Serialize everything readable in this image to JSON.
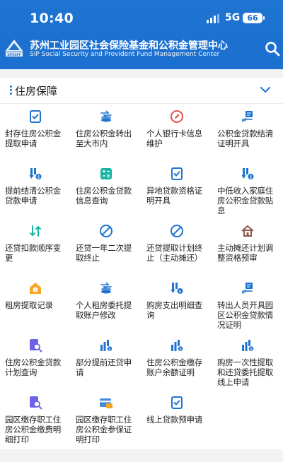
{
  "status_bar": {
    "time": "10:40",
    "network": "5G",
    "battery": "66"
  },
  "header": {
    "title_cn": "苏州工业园区社会保险基金和公积金管理中心",
    "title_en": "SIP Social Security and Provident Fund Management Center",
    "logo_text": "SIPSSPF",
    "search_icon": "search-icon"
  },
  "section": {
    "title": "住房保障",
    "toggle_icon": "chevron-down-icon"
  },
  "colors": {
    "primary": "#1f74d1",
    "red": "#e5534b",
    "orange": "#f5a623",
    "green": "#17b3a3",
    "purple": "#6d63e8",
    "brown": "#8c5a4e"
  },
  "items": [
    {
      "label": "封存住房公积金提取申请",
      "icon": "doc-check-icon"
    },
    {
      "label": "住房公积金转出至大市内",
      "icon": "coins-transfer-icon"
    },
    {
      "label": "个人银行卡信息维护",
      "icon": "edit-circle-icon"
    },
    {
      "label": "公积金贷款结清证明开具",
      "icon": "hand-card-icon"
    },
    {
      "label": "提前结清公积金贷款申请",
      "icon": "down-coin-icon"
    },
    {
      "label": "住房公积金贷款信息查询",
      "icon": "calculator-icon"
    },
    {
      "label": "异地贷款资格证明开具",
      "icon": "doc-check-icon"
    },
    {
      "label": "中低收入家庭住房公积金贷款贴息",
      "icon": "down-coin-icon"
    },
    {
      "label": "还贷扣款顺序变更",
      "icon": "swap-arrows-icon"
    },
    {
      "label": "还贷一年二次提取终止",
      "icon": "stop-circle-icon"
    },
    {
      "label": "还贷提取计划终止（主动摊还）",
      "icon": "stop-circle-icon"
    },
    {
      "label": "主动摊还计划调整资格预审",
      "icon": "house-icon"
    },
    {
      "label": "租房提取记录",
      "icon": "house-coin-icon"
    },
    {
      "label": "个人租房委托提取账户修改",
      "icon": "coins-transfer-icon"
    },
    {
      "label": "购房支出明细查询",
      "icon": "down-coin-icon"
    },
    {
      "label": "转出人员开具园区公积金贷款情况证明",
      "icon": "hand-card-icon"
    },
    {
      "label": "住房公积金贷款计划查询",
      "icon": "doc-search-icon"
    },
    {
      "label": "部分提前还贷申请",
      "icon": "bar-coin-icon"
    },
    {
      "label": "住房公积金缴存账户余额证明",
      "icon": "bar-coin-icon"
    },
    {
      "label": "购房一次性提取和还贷委托提取线上申请",
      "icon": "bar-coin-icon"
    },
    {
      "label": "园区缴存职工住房公积金缴费明细打印",
      "icon": "doc-search-icon"
    },
    {
      "label": "园区缴存职工住房公积金参保证明打印",
      "icon": "card-icon"
    },
    {
      "label": "线上贷款预申请",
      "icon": "doc-check-icon"
    }
  ]
}
